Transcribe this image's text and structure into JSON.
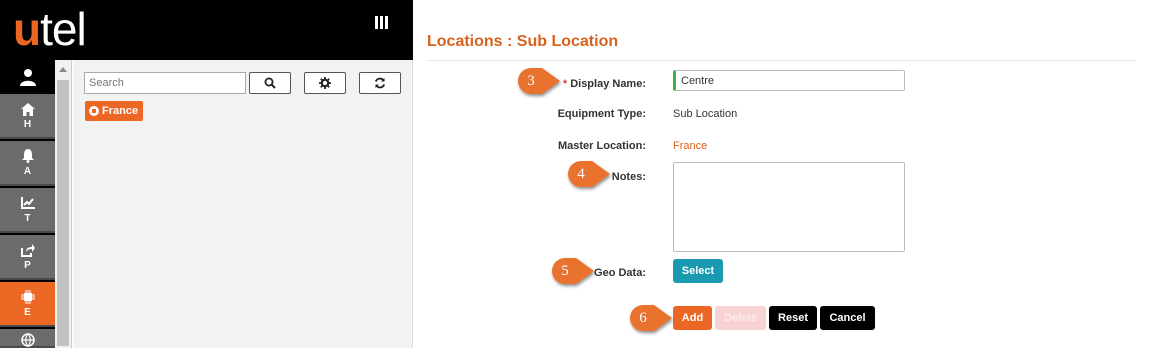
{
  "app": {
    "logo_u": "u",
    "logo_rest": "tel"
  },
  "nav": {
    "items": [
      {
        "label": "H",
        "icon": "home-icon"
      },
      {
        "label": "A",
        "icon": "bell-icon"
      },
      {
        "label": "T",
        "icon": "trend-chart-icon"
      },
      {
        "label": "P",
        "icon": "share-icon"
      },
      {
        "label": "E",
        "icon": "chip-icon",
        "active": true
      }
    ]
  },
  "tree": {
    "search_placeholder": "Search",
    "node_label": "France"
  },
  "page": {
    "title": "Locations : Sub Location"
  },
  "form": {
    "required_mark": "*",
    "display_name_label": "Display Name:",
    "display_name_value": "Centre",
    "equipment_type_label": "Equipment Type:",
    "equipment_type_value": "Sub Location",
    "master_location_label": "Master Location:",
    "master_location_value": "France",
    "notes_label": "Notes:",
    "geo_data_label": "Geo Data:",
    "select_label": "Select"
  },
  "actions": {
    "add": "Add",
    "delete": "Delete",
    "reset": "Reset",
    "cancel": "Cancel"
  },
  "callouts": [
    "3",
    "4",
    "5",
    "6"
  ],
  "colors": {
    "brand_orange": "#ec6624",
    "title_orange": "#d7621d",
    "teal": "#1a9ab0",
    "valid_green": "#3db34a"
  }
}
